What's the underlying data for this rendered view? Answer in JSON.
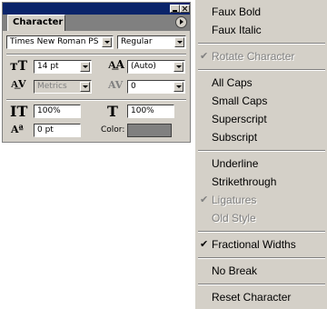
{
  "palette": {
    "tab_label": "Character",
    "font_family": "Times New Roman PS",
    "font_style": "Regular",
    "font_size": "14 pt",
    "leading": "(Auto)",
    "kerning": "Metrics",
    "tracking": "0",
    "vertical_scale": "100%",
    "horizontal_scale": "100%",
    "baseline_shift": "0 pt",
    "color_label": "Color:",
    "color_value": "#808080"
  },
  "menu": {
    "items": [
      {
        "label": "Faux Bold",
        "enabled": true,
        "checked": false
      },
      {
        "label": "Faux Italic",
        "enabled": true,
        "checked": false
      },
      {
        "label": "Rotate Character",
        "enabled": false,
        "checked": true
      },
      {
        "label": "All Caps",
        "enabled": true,
        "checked": false
      },
      {
        "label": "Small Caps",
        "enabled": true,
        "checked": false
      },
      {
        "label": "Superscript",
        "enabled": true,
        "checked": false
      },
      {
        "label": "Subscript",
        "enabled": true,
        "checked": false
      },
      {
        "label": "Underline",
        "enabled": true,
        "checked": false
      },
      {
        "label": "Strikethrough",
        "enabled": true,
        "checked": false
      },
      {
        "label": "Ligatures",
        "enabled": false,
        "checked": true
      },
      {
        "label": "Old Style",
        "enabled": false,
        "checked": false
      },
      {
        "label": "Fractional Widths",
        "enabled": true,
        "checked": true
      },
      {
        "label": "No Break",
        "enabled": true,
        "checked": false
      },
      {
        "label": "Reset Character",
        "enabled": true,
        "checked": false
      }
    ],
    "check_glyph": "✔"
  }
}
